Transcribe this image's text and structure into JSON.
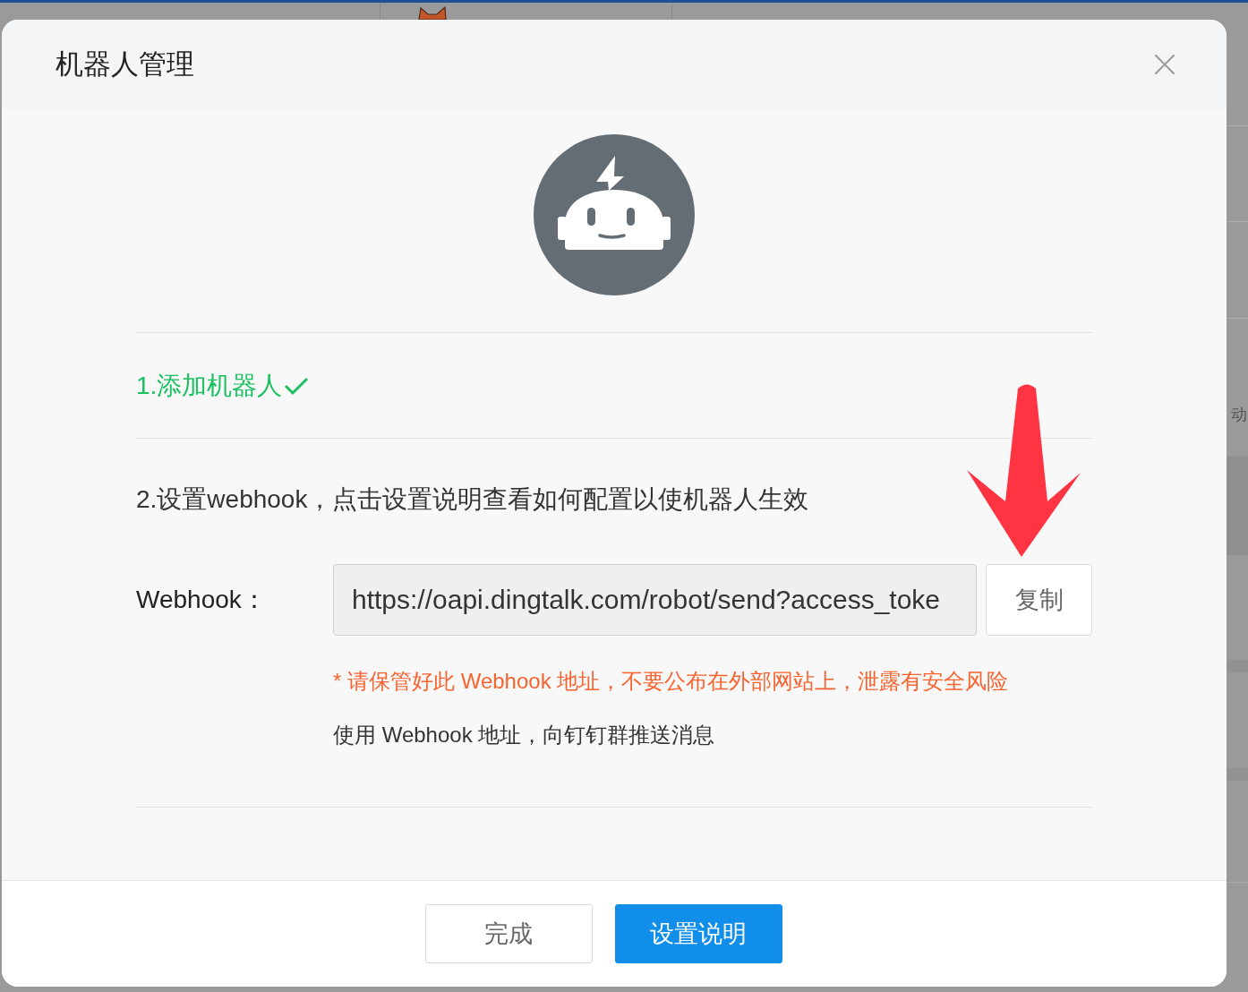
{
  "background_page": {
    "text_fragment": "动"
  },
  "dialog": {
    "title": "机器人管理",
    "steps": [
      {
        "text": "1.添加机器人",
        "done": true
      },
      {
        "text": "2.设置webhook，点击设置说明查看如何配置以使机器人生效",
        "done": false
      }
    ],
    "webhook": {
      "label": "Webhook：",
      "value": "https://oapi.dingtalk.com/robot/send?access_toke",
      "copy_button": "复制"
    },
    "warning": "* 请保管好此 Webhook 地址，不要公布在外部网站上，泄露有安全风险",
    "hint": "使用 Webhook 地址，向钉钉群推送消息",
    "buttons": [
      {
        "label": "完成",
        "kind": "default"
      },
      {
        "label": "设置说明",
        "kind": "primary"
      }
    ]
  }
}
